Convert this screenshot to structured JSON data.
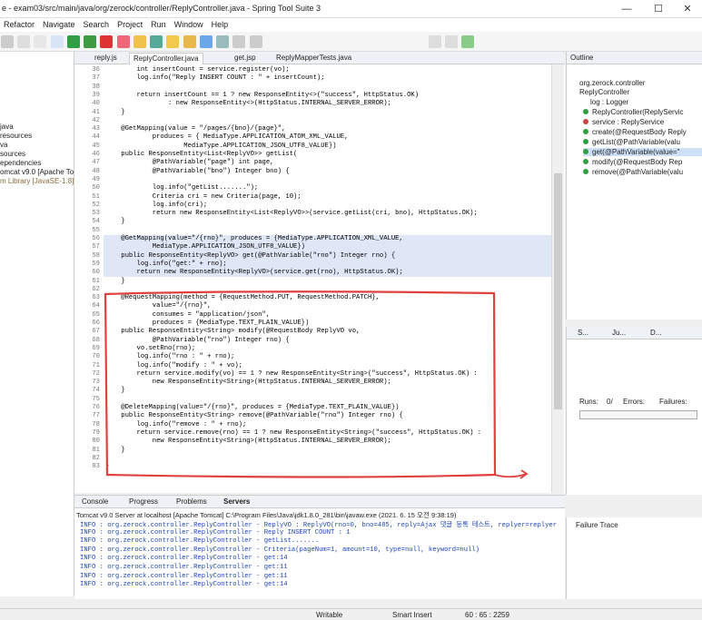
{
  "window": {
    "title": "e - exam03/src/main/java/org/zerock/controller/ReplyController.java - Spring Tool Suite 3",
    "minimize": "—",
    "maximize": "☐",
    "close": "✕"
  },
  "menu": [
    "Refactor",
    "Navigate",
    "Search",
    "Project",
    "Run",
    "Window",
    "Help"
  ],
  "left_tree": [
    "java",
    "resources",
    "va",
    "sources",
    "ependencies",
    "omcat v9.0 [Apache Tom",
    "m Library [JavaSE-1.8]"
  ],
  "editor_tabs": [
    "reply.js",
    "ReplyController.java",
    "get.jsp",
    "ReplyMapperTests.java"
  ],
  "line_numbers": [
    "36",
    "37",
    "38",
    "39",
    "40",
    "41",
    "42",
    "43",
    "44",
    "45",
    "46",
    "47",
    "48",
    "49",
    "50",
    "51",
    "52",
    "53",
    "54",
    "55",
    "56",
    "57",
    "58",
    "59",
    "60",
    "61",
    "62",
    "63",
    "64",
    "65",
    "66",
    "67",
    "68",
    "69",
    "70",
    "71",
    "72",
    "73",
    "74",
    "75",
    "76",
    "77",
    "78",
    "79",
    "80",
    "81",
    "82",
    "83"
  ],
  "code": [
    "        int insertCount = service.register(vo);",
    "        log.info(\"Reply INSERT COUNT : \" + insertCount);",
    "",
    "        return insertCount == 1 ? new ResponseEntity<>(\"success\", HttpStatus.OK)",
    "                : new ResponseEntity<>(HttpStatus.INTERNAL_SERVER_ERROR);",
    "    }",
    "",
    "    @GetMapping(value = \"/pages/{bno}/{page}\",",
    "            produces = { MediaType.APPLICATION_ATOM_XML_VALUE,",
    "                    MediaType.APPLICATION_JSON_UTF8_VALUE})",
    "    public ResponseEntity<List<ReplyVO>> getList(",
    "            @PathVariable(\"page\") int page,",
    "            @PathVariable(\"bno\") Integer bno) {",
    "",
    "            log.info(\"getList.......\");",
    "            Criteria cri = new Criteria(page, 10);",
    "            log.info(cri);",
    "            return new ResponseEntity<List<ReplyVO>>(service.getList(cri, bno), HttpStatus.OK);",
    "    }",
    "",
    "    @GetMapping(value=\"/{rno}\", produces = {MediaType.APPLICATION_XML_VALUE,",
    "            MediaType.APPLICATION_JSON_UTF8_VALUE})",
    "    public ResponseEntity<ReplyVO> get(@PathVariable(\"rno\") Integer rno) {",
    "        log.info(\"get:\" + rno);",
    "        return new ResponseEntity<ReplyVO>(service.get(rno), HttpStatus.OK);",
    "    }",
    "",
    "    @RequestMapping(method = {RequestMethod.PUT, RequestMethod.PATCH},",
    "            value=\"/{rno}\",",
    "            consumes = \"application/json\",",
    "            produces = {MediaType.TEXT_PLAIN_VALUE})",
    "    public ResponseEntity<String> modify(@RequestBody ReplyVO vo,",
    "            @PathVariable(\"rno\") Integer rno) {",
    "        vo.setRno(rno);",
    "        log.info(\"rno : \" + rno);",
    "        log.info(\"modify : \" + vo);",
    "        return service.modify(vo) == 1 ? new ResponseEntity<String>(\"success\", HttpStatus.OK) :",
    "            new ResponseEntity<String>(HttpStatus.INTERNAL_SERVER_ERROR);",
    "    }",
    "",
    "    @DeleteMapping(value=\"/{rno}\", produces = {MediaType.TEXT_PLAIN_VALUE})",
    "    public ResponseEntity<String> remove(@PathVariable(\"rno\") Integer rno) {",
    "        log.info(\"remove : \" + rno);",
    "        return service.remove(rno) == 1 ? new ResponseEntity<String>(\"success\", HttpStatus.OK) :",
    "            new ResponseEntity<String>(HttpStatus.INTERNAL_SERVER_ERROR);",
    "    }",
    "",
    "}"
  ],
  "outline": {
    "title": "Outline",
    "items": [
      "org.zerock.controller",
      "ReplyController",
      "log : Logger",
      "ReplyController(ReplyServic",
      "service : ReplyService",
      "create(@RequestBody Reply",
      "getList(@PathVariable(valu",
      "get(@PathVariable(value=\"",
      "modify(@RequestBody Rep",
      "remove(@PathVariable(valu"
    ]
  },
  "junit": {
    "tabs": [
      "S...",
      "Ju...",
      "D..."
    ],
    "runs": "Runs:",
    "runs_value": "0/",
    "errors": "Errors:",
    "failures": "Failures:"
  },
  "console": {
    "tabs": [
      "Console",
      "Progress",
      "Problems",
      "Servers"
    ],
    "server_line": "Tomcat v9.0 Server at localhost [Apache Tomcat] C:\\Program Files\\Java\\jdk1.8.0_281\\bin\\javaw.exe  (2021. 6. 15 오전 9:38:19)",
    "lines": [
      "INFO : org.zerock.controller.ReplyController - ReplyVO : ReplyVO(rno=0, bno=485, reply=Ajax 댓글 등록 테스트, replyer=replyer",
      "INFO : org.zerock.controller.ReplyController - Reply INSERT COUNT : 1",
      "INFO : org.zerock.controller.ReplyController - getList.......",
      "INFO : org.zerock.controller.ReplyController - Criteria(pageNum=1, amount=10, type=null, keyword=null)",
      "INFO : org.zerock.controller.ReplyController - get:14",
      "INFO : org.zerock.controller.ReplyController - get:11",
      "INFO : org.zerock.controller.ReplyController - get:11",
      "INFO : org.zerock.controller.ReplyController - get:14"
    ]
  },
  "failure_trace": "Failure Trace",
  "status": {
    "mode": "Writable",
    "insert": "Smart Insert",
    "position": "60 : 65 : 2259"
  },
  "colors": {
    "annotation_box": "#e0413f",
    "highlight": "#dfe6f5"
  }
}
